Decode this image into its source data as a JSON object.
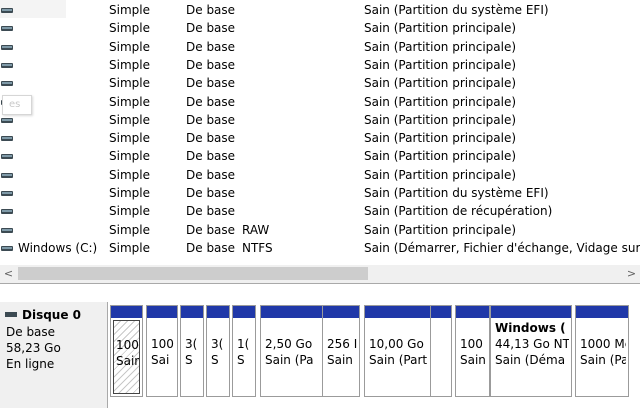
{
  "volumes": [
    {
      "name": "",
      "layout": "Simple",
      "type": "De base",
      "fs": "",
      "status": "Sain (Partition du système EFI)"
    },
    {
      "name": "",
      "layout": "Simple",
      "type": "De base",
      "fs": "",
      "status": "Sain (Partition principale)"
    },
    {
      "name": "",
      "layout": "Simple",
      "type": "De base",
      "fs": "",
      "status": "Sain (Partition principale)"
    },
    {
      "name": "",
      "layout": "Simple",
      "type": "De base",
      "fs": "",
      "status": "Sain (Partition principale)"
    },
    {
      "name": "",
      "layout": "Simple",
      "type": "De base",
      "fs": "",
      "status": "Sain (Partition principale)"
    },
    {
      "name": "",
      "layout": "Simple",
      "type": "De base",
      "fs": "",
      "status": "Sain (Partition principale)"
    },
    {
      "name": "",
      "layout": "Simple",
      "type": "De base",
      "fs": "",
      "status": "Sain (Partition principale)"
    },
    {
      "name": "",
      "layout": "Simple",
      "type": "De base",
      "fs": "",
      "status": "Sain (Partition principale)"
    },
    {
      "name": "",
      "layout": "Simple",
      "type": "De base",
      "fs": "",
      "status": "Sain (Partition principale)"
    },
    {
      "name": "",
      "layout": "Simple",
      "type": "De base",
      "fs": "",
      "status": "Sain (Partition principale)"
    },
    {
      "name": "",
      "layout": "Simple",
      "type": "De base",
      "fs": "",
      "status": "Sain (Partition du système EFI)"
    },
    {
      "name": "",
      "layout": "Simple",
      "type": "De base",
      "fs": "",
      "status": "Sain (Partition de récupération)"
    },
    {
      "name": "",
      "layout": "Simple",
      "type": "De base",
      "fs": "RAW",
      "status": "Sain (Partition principale)"
    },
    {
      "name": "Windows (C:)",
      "layout": "Simple",
      "type": "De base",
      "fs": "NTFS",
      "status": "Sain (Démarrer, Fichier d'échange, Vidage sur inc"
    }
  ],
  "tooltip_text": "es",
  "scrollbar": {
    "left_arrow": "<",
    "right_arrow": ">"
  },
  "disk": {
    "title": "Disque 0",
    "type": "De base",
    "size": "58,23 Go",
    "state": "En ligne"
  },
  "partitions": [
    {
      "name": "",
      "size": "100",
      "status": "Sain",
      "selected": true
    },
    {
      "name": "",
      "size": "100",
      "status": "Sai"
    },
    {
      "name": "",
      "size": "3(",
      "status": "S"
    },
    {
      "name": "",
      "size": "3(",
      "status": "S"
    },
    {
      "name": "",
      "size": "1(",
      "status": "S"
    },
    {
      "name": "",
      "size": "2,50 Go",
      "status": "Sain (Pa"
    },
    {
      "name": "",
      "size": "256 I",
      "status": "Sain"
    },
    {
      "name": "",
      "size": "10,00 Go",
      "status": "Sain (Part"
    },
    {
      "name": "",
      "size": "",
      "status": ""
    },
    {
      "name": "",
      "size": "100",
      "status": "Sain"
    },
    {
      "name": "Windows (",
      "size": "44,13 Go NT",
      "status": "Sain (Déma"
    },
    {
      "name": "",
      "size": "1000 Mc",
      "status": "Sain (Pa"
    }
  ]
}
